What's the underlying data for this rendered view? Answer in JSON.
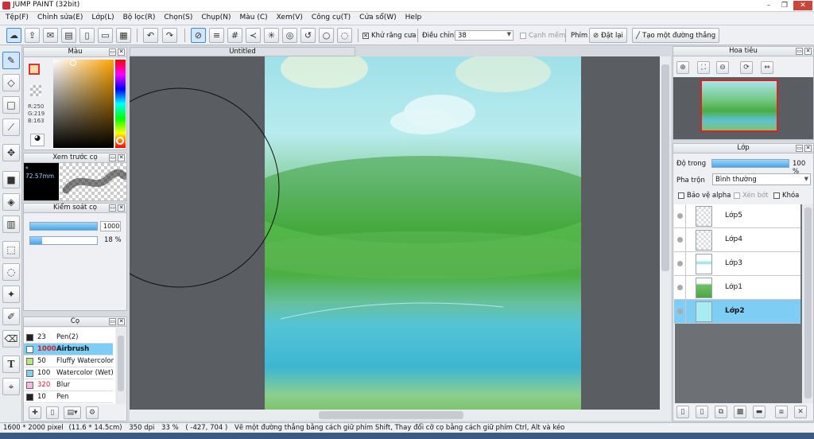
{
  "window": {
    "title": "JUMP PAINT (32bit)",
    "minimize": "–",
    "maximize": "❐",
    "close": "✕"
  },
  "menu": [
    "Tệp(F)",
    "Chỉnh sửa(E)",
    "Lớp(L)",
    "Bộ lọc(R)",
    "Chọn(S)",
    "Chụp(N)",
    "Màu (C)",
    "Xem(V)",
    "Công cụ(T)",
    "Cửa sổ(W)",
    "Help"
  ],
  "toolbar": {
    "antialias_label": "Khử răng cưa",
    "antialias_checked": true,
    "adjust_label": "Điều chỉnh",
    "adjust_value": "38",
    "edge_label": "Cạnh mềm",
    "key_label": "Phím",
    "reset_label": "Đặt lại",
    "straight_line_label": "Tạo một đường thẳng"
  },
  "color_panel": {
    "title": "Màu",
    "r": "R:250",
    "g": "G:219",
    "b": "B:163",
    "primary": "#fadba3"
  },
  "brush_preview": {
    "title": "Xem trước cọ",
    "size": "* 72.57mm"
  },
  "brush_control": {
    "title": "Kiểm soát cọ",
    "size_value": "1000",
    "opacity_value": "18 %",
    "size_level": 1.0,
    "opacity_level": 0.18
  },
  "brush_panel": {
    "title": "Cọ",
    "items": [
      {
        "size": "23",
        "name": "Pen(2)",
        "color": "#222222",
        "active": false
      },
      {
        "size": "1000",
        "name": "Airbrush",
        "color": "#ffffff",
        "active": true
      },
      {
        "size": "50",
        "name": "Fluffy Watercolor",
        "color": "#b7e67a",
        "active": false
      },
      {
        "size": "100",
        "name": "Watercolor (Wet)",
        "color": "#7fd3f2",
        "active": false
      },
      {
        "size": "320",
        "name": "Blur",
        "color": "#f7b8e3",
        "active": false
      },
      {
        "size": "10",
        "name": "Pen",
        "color": "#222222",
        "active": false
      }
    ]
  },
  "canvas": {
    "tab_title": "Untitled"
  },
  "navigator": {
    "title": "Hoa tiêu"
  },
  "layer_panel": {
    "title": "Lớp",
    "opacity_label": "Độ trong",
    "opacity_value": "100 %",
    "opacity_level": 1.0,
    "blend_label": "Pha trộn",
    "blend_value": "Bình thường",
    "protect_alpha": "Bảo vệ alpha",
    "clipping": "Xén bớt",
    "lock": "Khóa",
    "layers": [
      {
        "name": "Lớp5",
        "active": false
      },
      {
        "name": "Lớp4",
        "active": false
      },
      {
        "name": "Lớp3",
        "active": false
      },
      {
        "name": "Lớp1",
        "active": false
      },
      {
        "name": "Lớp2",
        "active": true
      }
    ]
  },
  "status": {
    "size": "1600 * 2000 pixel",
    "physical": "(11.6 * 14.5cm)",
    "dpi": "350 dpi",
    "zoom": "33 %",
    "coords": "( -427, 704 )",
    "hint": "Vẽ một đường thẳng bằng cách giữ phím Shift, Thay đổi cỡ cọ bằng cách giữ phím Ctrl, Alt và kéo"
  },
  "colors": {
    "accent": "#3c8ad6",
    "selected_row": "#7ecdf5",
    "canvas_bg": "#5a5d62"
  }
}
